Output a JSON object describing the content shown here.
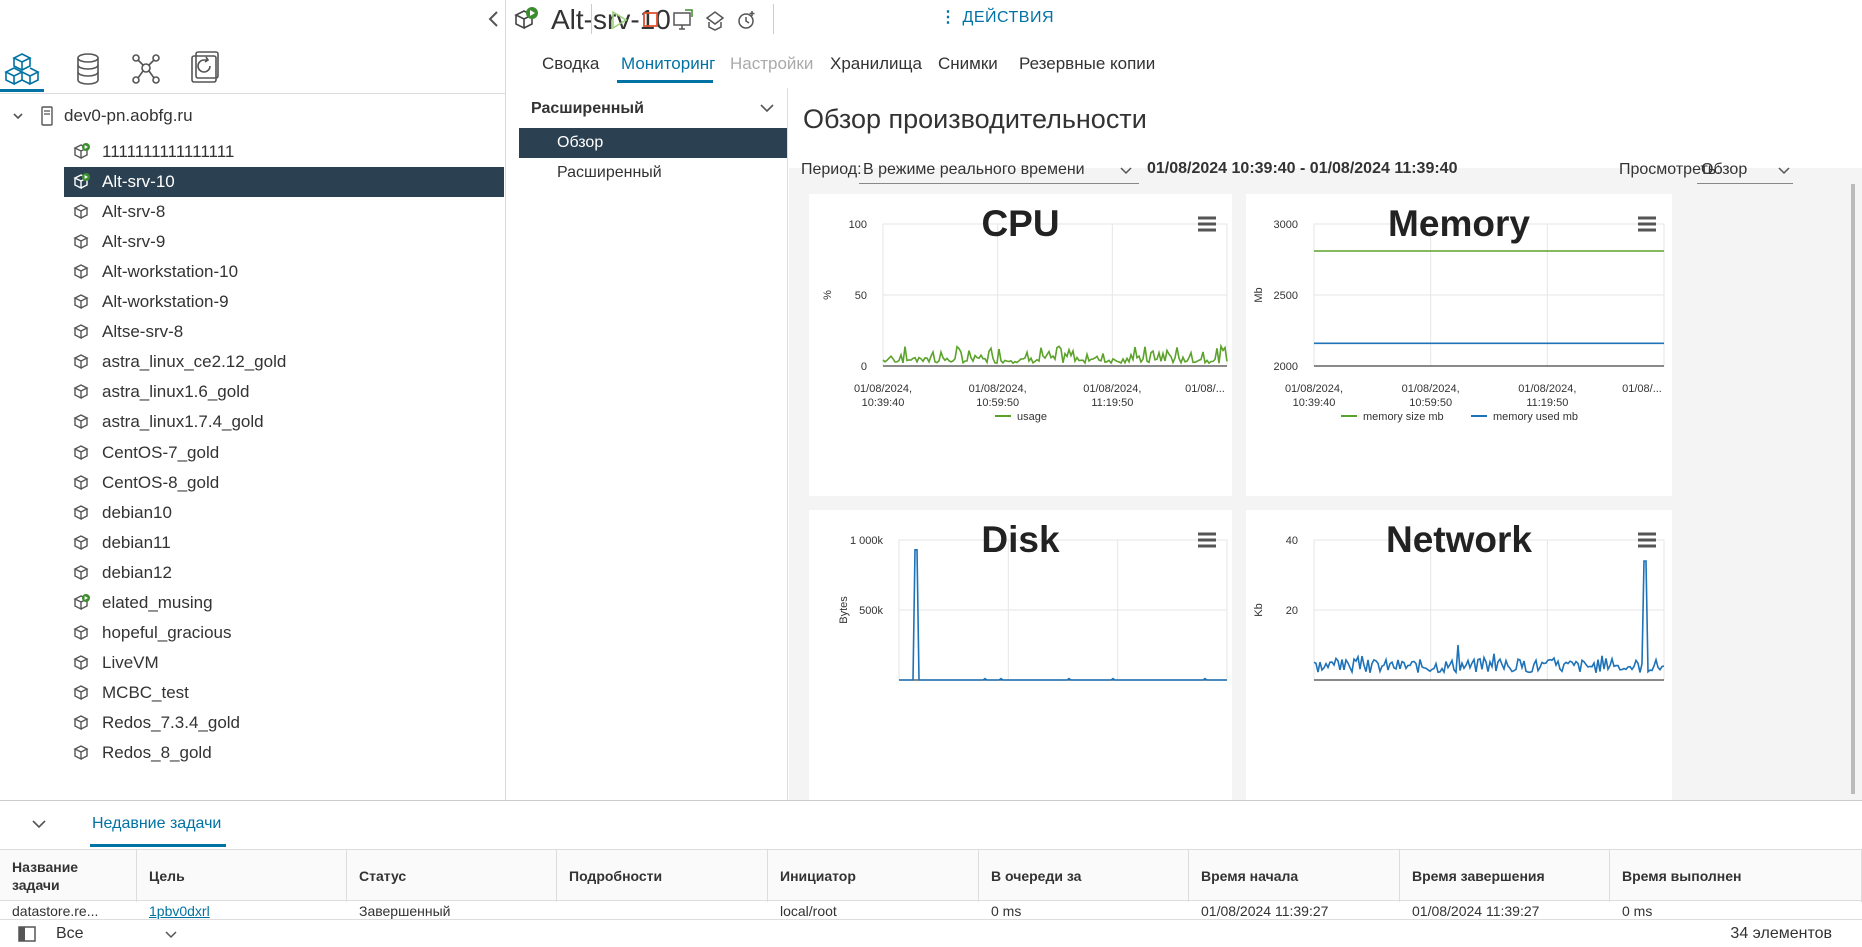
{
  "sidebar": {
    "host": "dev0-pn.aobfg.ru",
    "vms": [
      {
        "label": "1111111111111111",
        "running": true
      },
      {
        "label": "Alt-srv-10",
        "running": true,
        "selected": true
      },
      {
        "label": "Alt-srv-8",
        "running": false
      },
      {
        "label": "Alt-srv-9",
        "running": false
      },
      {
        "label": "Alt-workstation-10",
        "running": false
      },
      {
        "label": "Alt-workstation-9",
        "running": false
      },
      {
        "label": "Altse-srv-8",
        "running": false
      },
      {
        "label": "astra_linux_ce2.12_gold",
        "running": false
      },
      {
        "label": "astra_linux1.6_gold",
        "running": false
      },
      {
        "label": "astra_linux1.7.4_gold",
        "running": false
      },
      {
        "label": "CentOS-7_gold",
        "running": false
      },
      {
        "label": "CentOS-8_gold",
        "running": false
      },
      {
        "label": "debian10",
        "running": false
      },
      {
        "label": "debian11",
        "running": false
      },
      {
        "label": "debian12",
        "running": false
      },
      {
        "label": "elated_musing",
        "running": true
      },
      {
        "label": "hopeful_gracious",
        "running": false
      },
      {
        "label": "LiveVM",
        "running": false
      },
      {
        "label": "MCBC_test",
        "running": false
      },
      {
        "label": "Redos_7.3.4_gold",
        "running": false
      },
      {
        "label": "Redos_8_gold",
        "running": false
      }
    ]
  },
  "header": {
    "title": "Alt-srv-10",
    "actions": "ДЕЙСТВИЯ",
    "tabs": [
      "Сводка",
      "Мониторинг",
      "Настройки",
      "Хранилища",
      "Снимки",
      "Резервные копии"
    ]
  },
  "submenu": {
    "heading": "Расширенный",
    "items": [
      "Обзор",
      "Расширенный"
    ]
  },
  "main": {
    "title": "Обзор производительности",
    "period_label": "Период:",
    "period_value": "В режиме реального времени",
    "range": "01/08/2024 10:39:40 - 01/08/2024 11:39:40",
    "view_label": "Просмотреть:",
    "view_value": "Обзор"
  },
  "colors": {
    "green": "#5ba22a",
    "blue": "#1d72b8",
    "selected_bg": "#2b4050",
    "accent": "#0072a3"
  },
  "chart_data": [
    {
      "type": "line",
      "title": "CPU",
      "ylabel": "%",
      "ylim": [
        0,
        100
      ],
      "yticks": [
        "100",
        "50",
        "0"
      ],
      "xticks": [
        [
          "01/08/2024,",
          "10:39:40"
        ],
        [
          "01/08/2024,",
          "10:59:50"
        ],
        [
          "01/08/2024,",
          "11:19:50"
        ],
        [
          "01/08/...",
          ""
        ]
      ],
      "series": [
        {
          "name": "usage",
          "color": "#5ba22a",
          "approx_range": [
            2,
            14
          ]
        }
      ]
    },
    {
      "type": "line",
      "title": "Memory",
      "ylabel": "Mb",
      "ylim": [
        2000,
        3000
      ],
      "yticks": [
        "3000",
        "2500",
        "2000"
      ],
      "xticks": [
        [
          "01/08/2024,",
          "10:39:40"
        ],
        [
          "01/08/2024,",
          "10:59:50"
        ],
        [
          "01/08/2024,",
          "11:19:50"
        ],
        [
          "01/08/...",
          ""
        ]
      ],
      "series": [
        {
          "name": "memory size mb",
          "color": "#5ba22a",
          "value": 2810
        },
        {
          "name": "memory used mb",
          "color": "#1d72b8",
          "value": 2160
        }
      ]
    },
    {
      "type": "line",
      "title": "Disk",
      "ylabel": "Bytes",
      "ylim": [
        0,
        1000000
      ],
      "yticks": [
        "1 000k",
        "500k"
      ],
      "series": [
        {
          "color": "#1d72b8",
          "peak": 930000
        }
      ]
    },
    {
      "type": "line",
      "title": "Network",
      "ylabel": "Kb",
      "ylim": [
        0,
        40
      ],
      "yticks": [
        "40",
        "20"
      ],
      "series": [
        {
          "color": "#1d72b8",
          "peak": 34
        }
      ]
    }
  ],
  "bottom": {
    "tab": "Недавние задачи",
    "columns": [
      [
        "Название",
        "задачи"
      ],
      [
        "Цель",
        ""
      ],
      [
        "Статус",
        ""
      ],
      [
        "Подробности",
        ""
      ],
      [
        "Инициатор",
        ""
      ],
      [
        "В очереди за",
        ""
      ],
      [
        "Время начала",
        ""
      ],
      [
        "Время завершения",
        ""
      ],
      [
        "Время выполнен",
        ""
      ]
    ],
    "row": [
      "datastore.re...",
      "1pbv0dxrl",
      "Завершенный",
      "",
      "local/root",
      "0 ms",
      "01/08/2024 11:39:27",
      "01/08/2024 11:39:27",
      "0 ms"
    ],
    "filter": "Все",
    "count": "34 элементов"
  }
}
